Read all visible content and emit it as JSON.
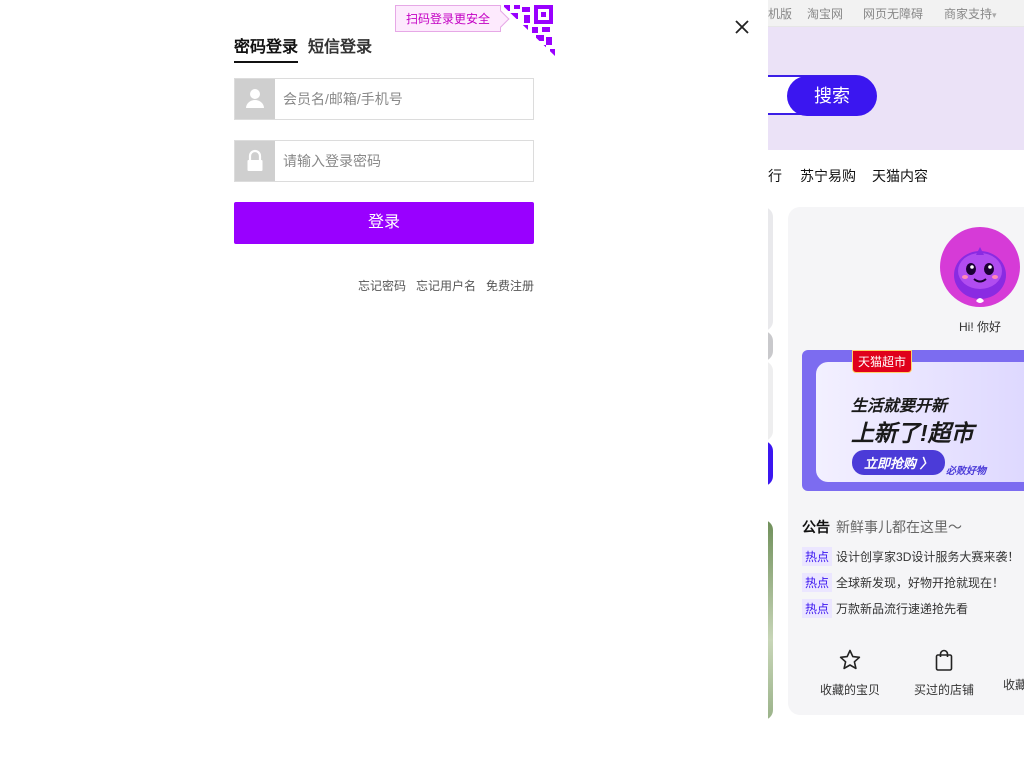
{
  "background_page": {
    "topbar": {
      "links": [
        "机版",
        "淘宝网",
        "网页无障碍",
        "商家支持"
      ]
    },
    "search": {
      "button_label": "搜索"
    },
    "nav": {
      "links": [
        "行",
        "苏宁易购",
        "天猫内容"
      ]
    },
    "user_card": {
      "greeting": "Hi! 你好",
      "promo": {
        "tag": "天猫超市",
        "line1": "生活就要开新",
        "line2": "上新了!超市",
        "button": "立即抢购 〉",
        "badge": "必败好物"
      },
      "notice": {
        "title": "公告",
        "subtitle": "新鲜事儿都在这里～",
        "items": [
          {
            "tag": "热点",
            "text": "设计创享家3D设计服务大赛来袭！"
          },
          {
            "tag": "热点",
            "text": "全球新发现，好物开抢就现在！"
          },
          {
            "tag": "热点",
            "text": "万款新品流行速递抢先看"
          }
        ]
      },
      "quick_links": [
        {
          "label": "收藏的宝贝",
          "icon": "star-icon"
        },
        {
          "label": "买过的店铺",
          "icon": "shopping-bag-icon"
        },
        {
          "label": "收藏",
          "icon": ""
        }
      ]
    }
  },
  "login": {
    "qr_hint": "扫码登录更安全",
    "tabs": [
      "密码登录",
      "短信登录"
    ],
    "active_tab": "密码登录",
    "username": {
      "placeholder": "会员名/邮箱/手机号",
      "value": "",
      "icon": "user-icon"
    },
    "password": {
      "placeholder": "请输入登录密码",
      "value": "",
      "icon": "lock-icon"
    },
    "submit_label": "登录",
    "links": [
      "忘记密码",
      "忘记用户名",
      "免费注册"
    ],
    "close_icon": "close-icon"
  },
  "colors": {
    "login_button": "#9900ff",
    "search_button": "#3b16f0",
    "header_band": "#ebe2f7",
    "qr_hint_text": "#c300c3"
  }
}
